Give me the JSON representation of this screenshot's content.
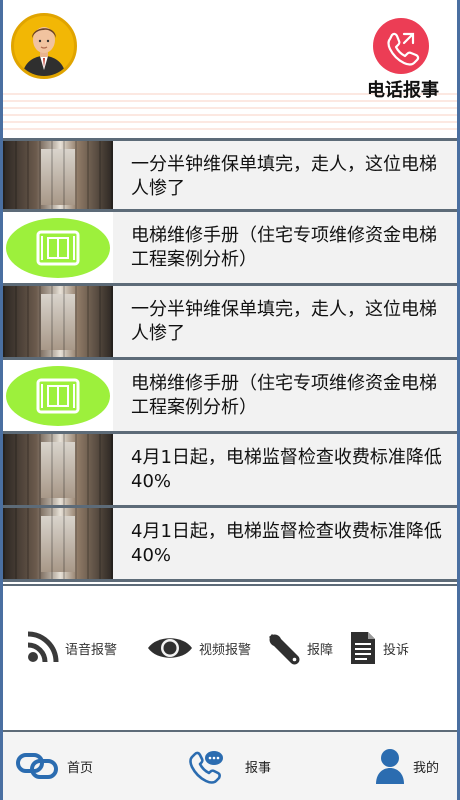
{
  "header": {
    "report_label": "电话报事"
  },
  "news": [
    {
      "thumb": "corridor",
      "text": "一分半钟维保单填完，走人，这位电梯人惨了"
    },
    {
      "thumb": "green-elevator",
      "text": "电梯维修手册（住宅专项维修资金电梯工程案例分析）"
    },
    {
      "thumb": "corridor",
      "text": "一分半钟维保单填完，走人，这位电梯人惨了"
    },
    {
      "thumb": "green-elevator",
      "text": "电梯维修手册（住宅专项维修资金电梯工程案例分析）"
    },
    {
      "thumb": "corridor",
      "text": "4月1日起，电梯监督检查收费标准降低40%"
    },
    {
      "thumb": "corridor",
      "text": "4月1日起，电梯监督检查收费标准降低40%"
    }
  ],
  "actions": {
    "voice": {
      "label": "语音报警",
      "icon": "rss-icon"
    },
    "video": {
      "label": "视频报警",
      "icon": "eye-icon"
    },
    "fault": {
      "label": "报障",
      "icon": "wrench-icon"
    },
    "complaint": {
      "label": "投诉",
      "icon": "document-icon"
    }
  },
  "nav": {
    "home": "首页",
    "report": "报事",
    "mine": "我的"
  },
  "colors": {
    "accent_red": "#ec3d55",
    "nav_blue": "#2b6cb0",
    "green": "#9df03c",
    "frame": "#4a6fa1"
  }
}
